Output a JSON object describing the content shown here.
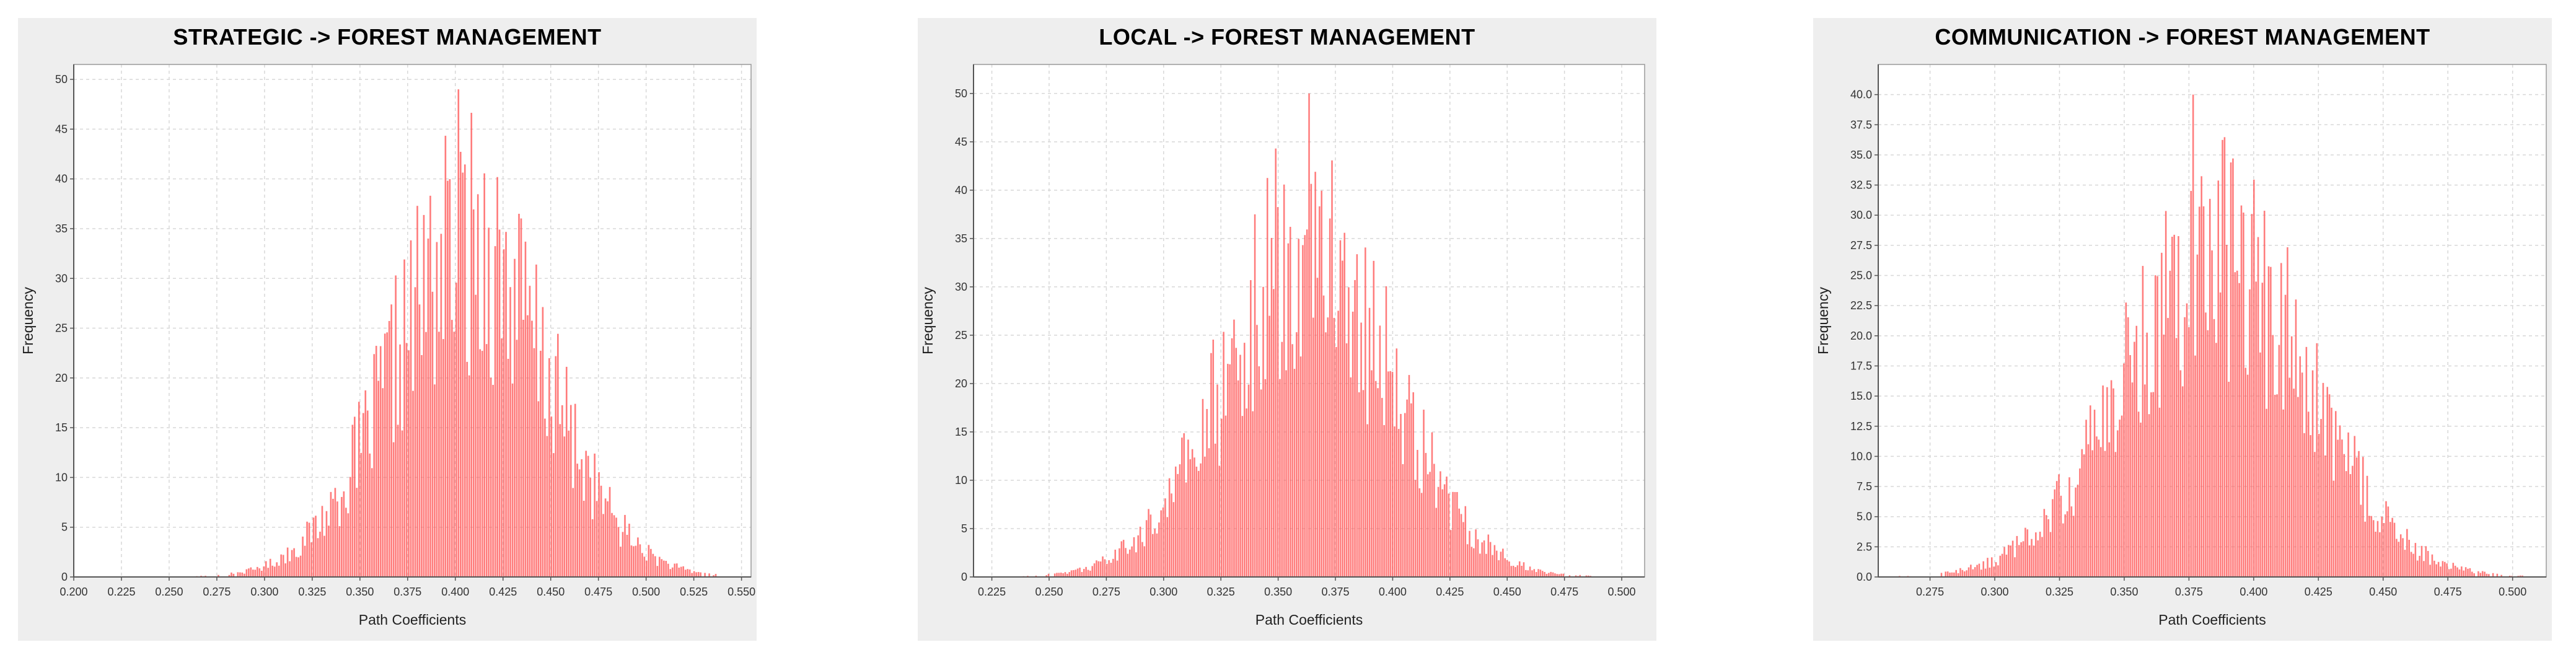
{
  "chart_data": [
    {
      "type": "bar",
      "title": "STRATEGIC -> FOREST MANAGEMENT",
      "xlabel": "Path Coefficients",
      "ylabel": "Frequency",
      "xlim": [
        0.2,
        0.555
      ],
      "ylim": [
        0,
        51.5
      ],
      "xticks": [
        "0.200",
        "0.225",
        "0.250",
        "0.275",
        "0.300",
        "0.325",
        "0.350",
        "0.375",
        "0.400",
        "0.425",
        "0.450",
        "0.475",
        "0.500",
        "0.525",
        "0.550"
      ],
      "yticks": [
        "0",
        "5",
        "10",
        "15",
        "20",
        "25",
        "30",
        "35",
        "40",
        "45",
        "50"
      ],
      "peak": {
        "x": 0.402,
        "y": 49
      },
      "bins": {
        "start": 0.205,
        "end": 0.545,
        "count": 300,
        "mean": 0.407,
        "sd": 0.041
      },
      "bar_color": "#ff5a5a",
      "grid": true,
      "legend": "none"
    },
    {
      "type": "bar",
      "title": "LOCAL -> FOREST MANAGEMENT",
      "xlabel": "Path Coefficients",
      "ylabel": "Frequency",
      "xlim": [
        0.217,
        0.51
      ],
      "ylim": [
        0,
        53
      ],
      "xticks": [
        "0.225",
        "0.250",
        "0.275",
        "0.300",
        "0.325",
        "0.350",
        "0.375",
        "0.400",
        "0.425",
        "0.450",
        "0.475",
        "0.500"
      ],
      "yticks": [
        "0",
        "5",
        "10",
        "15",
        "20",
        "25",
        "30",
        "35",
        "40",
        "45",
        "50"
      ],
      "peak": {
        "x": 0.364,
        "y": 50
      },
      "bins": {
        "start": 0.222,
        "end": 0.495,
        "count": 300,
        "mean": 0.363,
        "sd": 0.036
      },
      "bar_color": "#ff5a5a",
      "grid": true,
      "legend": "none"
    },
    {
      "type": "bar",
      "title": "COMMUNICATION -> FOREST MANAGEMENT",
      "xlabel": "Path Coefficients",
      "ylabel": "Frequency",
      "xlim": [
        0.255,
        0.513
      ],
      "ylim": [
        0,
        42.5
      ],
      "xticks": [
        "0.275",
        "0.300",
        "0.325",
        "0.350",
        "0.375",
        "0.400",
        "0.425",
        "0.450",
        "0.475",
        "0.500"
      ],
      "yticks": [
        "0.0",
        "2.5",
        "5.0",
        "7.5",
        "10.0",
        "12.5",
        "15.0",
        "17.5",
        "20.0",
        "22.5",
        "25.0",
        "27.5",
        "30.0",
        "32.5",
        "35.0",
        "37.5",
        "40.0"
      ],
      "peak": {
        "x": 0.377,
        "y": 40
      },
      "bins": {
        "start": 0.262,
        "end": 0.505,
        "count": 300,
        "mean": 0.385,
        "sd": 0.035
      },
      "bar_color": "#ff5a5a",
      "grid": true,
      "legend": "none"
    }
  ]
}
